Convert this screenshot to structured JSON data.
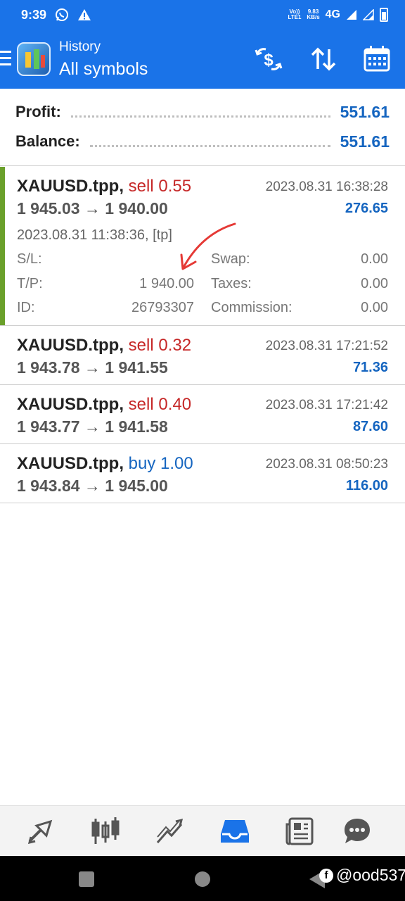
{
  "status_bar": {
    "time": "9:39",
    "volte": "Vo))",
    "lte": "LTE1",
    "speed_value": "9.83",
    "speed_unit": "KB/s",
    "network": "4G"
  },
  "app_bar": {
    "subtitle": "History",
    "title": "All symbols"
  },
  "summary": {
    "profit_label": "Profit:",
    "profit_value": "551.61",
    "balance_label": "Balance:",
    "balance_value": "551.61"
  },
  "deals": [
    {
      "symbol": "XAUUSD.tpp,",
      "side": "sell 0.55",
      "time": "2023.08.31 16:38:28",
      "prices": "1 945.03 → 1 940.00",
      "profit": "276.65",
      "open_time": "2023.08.31 11:38:36, [tp]",
      "sl_label": "S/L:",
      "sl_value": "",
      "tp_label": "T/P:",
      "tp_value": "1 940.00",
      "id_label": "ID:",
      "id_value": "26793307",
      "swap_label": "Swap:",
      "swap_value": "0.00",
      "taxes_label": "Taxes:",
      "taxes_value": "0.00",
      "commission_label": "Commission:",
      "commission_value": "0.00"
    },
    {
      "symbol": "XAUUSD.tpp,",
      "side": "sell 0.32",
      "time": "2023.08.31 17:21:52",
      "prices": "1 943.78 → 1 941.55",
      "profit": "71.36"
    },
    {
      "symbol": "XAUUSD.tpp,",
      "side": "sell 0.40",
      "time": "2023.08.31 17:21:42",
      "prices": "1 943.77 → 1 941.58",
      "profit": "87.60"
    },
    {
      "symbol": "XAUUSD.tpp,",
      "side": "buy 1.00",
      "time": "2023.08.31 08:50:23",
      "prices": "1 943.84 → 1 945.00",
      "profit": "116.00"
    }
  ],
  "bottom_nav": [
    "quotes-icon",
    "chart-icon",
    "trade-icon",
    "history-icon",
    "news-icon",
    "messages-icon"
  ],
  "watermark": "@ood537",
  "colors": {
    "primary": "#1a73e8",
    "sell": "#c62828",
    "buy": "#1565c0",
    "profit": "#1565c0",
    "expanded_marker": "#6aa02b",
    "annotation_arrow": "#e53935"
  }
}
